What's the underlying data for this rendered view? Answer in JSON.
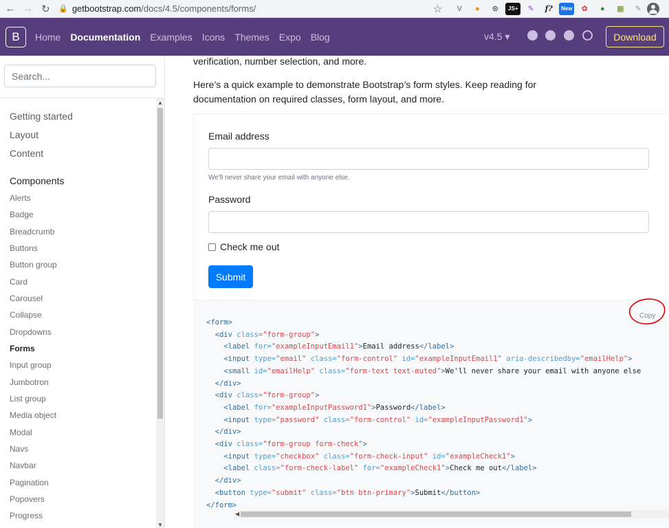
{
  "browser": {
    "url_host": "getbootstrap.com",
    "url_path": "/docs/4.5/components/forms/",
    "extensions": [
      "V",
      "●",
      "⊙",
      "JS+",
      "✎",
      "f?",
      "New",
      "✿",
      "●",
      "▦",
      "✎"
    ]
  },
  "navbar": {
    "brand": "B",
    "links": [
      "Home",
      "Documentation",
      "Examples",
      "Icons",
      "Themes",
      "Expo",
      "Blog"
    ],
    "version": "v4.5 ▾",
    "download": "Download"
  },
  "sidebar": {
    "search_placeholder": "Search...",
    "sections": [
      "Getting started",
      "Layout",
      "Content"
    ],
    "components_heading": "Components",
    "items": [
      "Alerts",
      "Badge",
      "Breadcrumb",
      "Buttons",
      "Button group",
      "Card",
      "Carousel",
      "Collapse",
      "Dropdowns",
      "Forms",
      "Input group",
      "Jumbotron",
      "List group",
      "Media object",
      "Modal",
      "Navs",
      "Navbar",
      "Pagination",
      "Popovers",
      "Progress"
    ],
    "active_item": "Forms"
  },
  "main": {
    "lead_fragment": "verification, number selection, and more.",
    "intro": "Here’s a quick example to demonstrate Bootstrap’s form styles. Keep reading for documentation on required classes, form layout, and more.",
    "form": {
      "email_label": "Email address",
      "email_help": "We'll never share your email with anyone else.",
      "password_label": "Password",
      "check_label": "Check me out",
      "submit_label": "Submit"
    },
    "copy_label": "Copy"
  },
  "colors": {
    "navbar_bg": "#563d7c",
    "download_accent": "#ffe484",
    "primary": "#007bff",
    "annotation": "#e00000"
  }
}
